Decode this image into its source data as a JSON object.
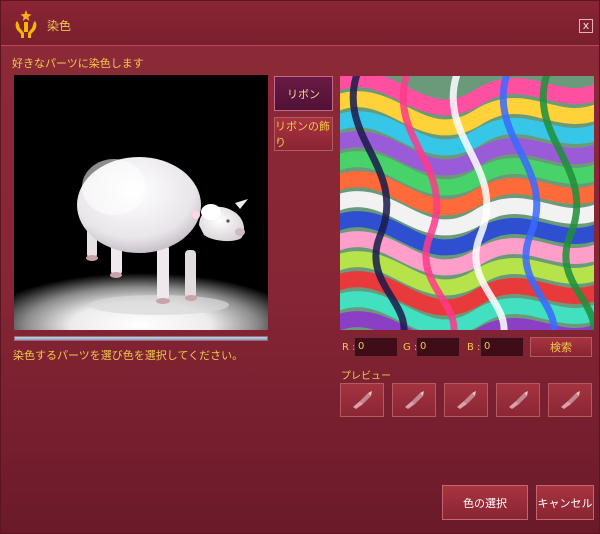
{
  "window": {
    "title": "染色",
    "close_label": "x"
  },
  "instructions": {
    "top": "好きなパーツに染色します",
    "bottom": "染色するパーツを選び色を選択してください。"
  },
  "progress": {
    "value": 1.0
  },
  "parts": [
    {
      "label": "リボン",
      "selected": true
    },
    {
      "label": "リボンの飾り",
      "selected": false
    }
  ],
  "rgb": {
    "r_label": "R :",
    "r_value": "0",
    "g_label": "G :",
    "g_value": "0",
    "b_label": "B :",
    "b_value": "0"
  },
  "search_label": "検索",
  "preview_label": "プレビュー",
  "preview_swatches": 5,
  "actions": {
    "select_color": "色の選択",
    "cancel": "キャンセル"
  },
  "icons": {
    "title": "hand-sparkle-icon",
    "swatch": "brush-icon"
  },
  "colors": {
    "accent_text": "#f2c94c",
    "window_bg": "#862535",
    "selected_part_bg": "#5a1538"
  }
}
